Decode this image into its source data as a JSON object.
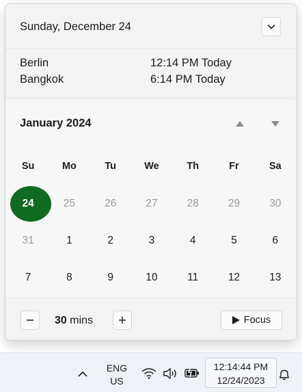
{
  "flyout": {
    "date_title": "Sunday, December 24",
    "clocks": [
      {
        "city": "Berlin",
        "time": "12:14 PM Today"
      },
      {
        "city": "Bangkok",
        "time": "6:14 PM Today"
      }
    ],
    "calendar": {
      "month_title": "January 2024",
      "weekdays": [
        "Su",
        "Mo",
        "Tu",
        "We",
        "Th",
        "Fr",
        "Sa"
      ],
      "weeks": [
        [
          "24",
          "25",
          "26",
          "27",
          "28",
          "29",
          "30"
        ],
        [
          "31",
          "1",
          "2",
          "3",
          "4",
          "5",
          "6"
        ],
        [
          "7",
          "8",
          "9",
          "10",
          "11",
          "12",
          "13"
        ]
      ],
      "today_accent": "#0f6b1f"
    },
    "focus": {
      "value": "30",
      "unit": "mins",
      "button_label": "Focus"
    }
  },
  "taskbar": {
    "lang_line1": "ENG",
    "lang_line2": "US",
    "time": "12:14:44 PM",
    "date": "12/24/2023"
  },
  "icons": [
    "chevron-down-icon",
    "chevron-up-icon",
    "triangle-up-icon",
    "triangle-down-icon",
    "minus-icon",
    "plus-icon",
    "play-icon",
    "wifi-icon",
    "volume-icon",
    "battery-icon",
    "bell-icon"
  ]
}
